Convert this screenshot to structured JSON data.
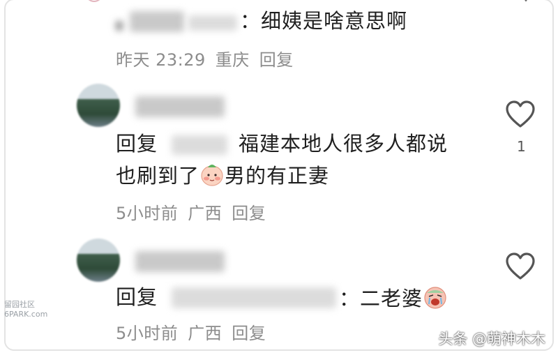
{
  "comment0": {
    "reply_suffix": "：细姨是啥意思啊",
    "time": "昨天 23:29",
    "location": "重庆",
    "reply_action": "回复"
  },
  "comment1": {
    "reply_prefix": "回复",
    "text_line1": "福建本地人很多人都说",
    "text_line2_a": "也刷到了",
    "text_line2_b": "男的有正妻",
    "time": "5小时前",
    "location": "广西",
    "reply_action": "回复",
    "like_count": "1"
  },
  "comment2": {
    "reply_prefix": "回复",
    "reply_suffix": "：二老婆",
    "time": "5小时前",
    "location": "广西",
    "reply_action": "回复"
  },
  "watermarks": {
    "left_line1": "留园社区",
    "left_line2": "6PARK.com",
    "right": "头条 @萌神木木"
  },
  "icons": {
    "like": "heart-outline-icon",
    "emoji_blush": "blushing-face-emoji",
    "emoji_crying": "crying-face-emoji"
  },
  "colors": {
    "text": "#1f1f1f",
    "meta": "#8c8c8c",
    "icon": "#555555"
  }
}
